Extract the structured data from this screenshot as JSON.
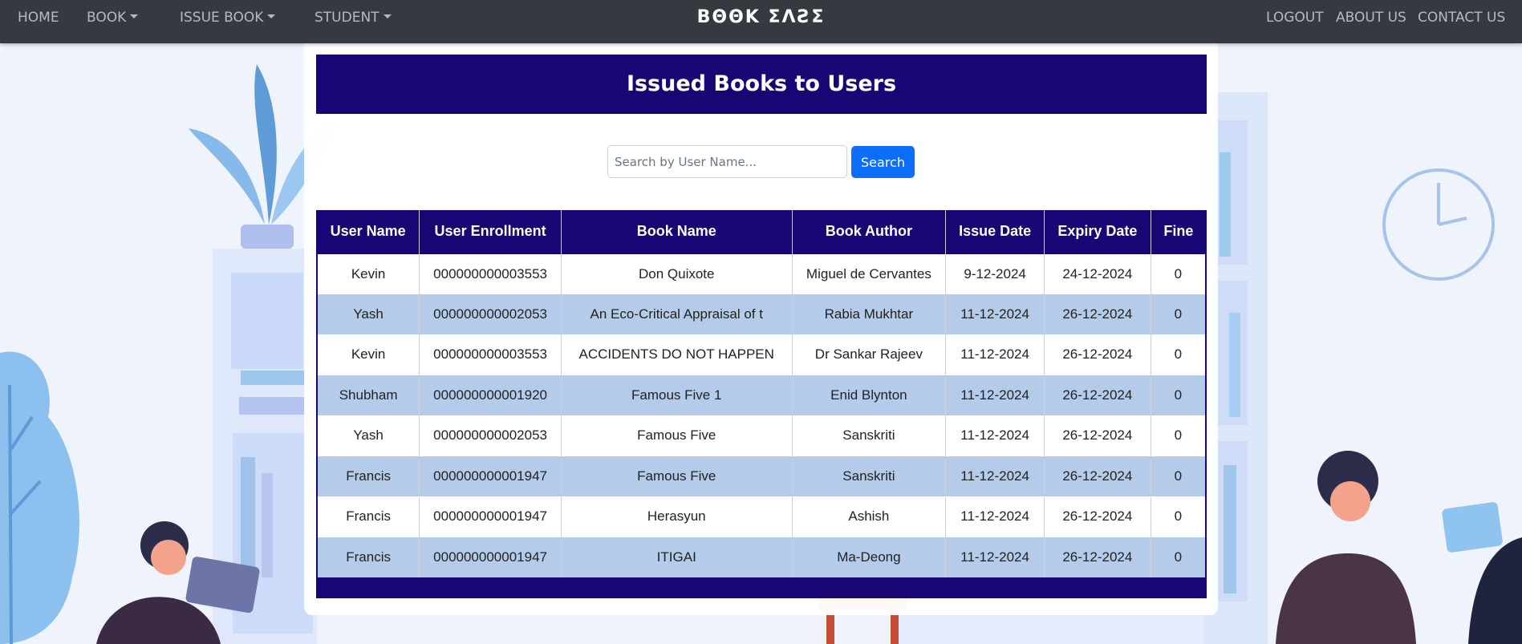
{
  "nav": {
    "home": "HOME",
    "book": "BOOK",
    "issue_book": "ISSUE BOOK",
    "student": "STUDENT",
    "brand": "BΘΘK ΣΛƧΣ",
    "logout": "LOGOUT",
    "about": "ABOUT US",
    "contact": "CONTACT US"
  },
  "page": {
    "title": "Issued Books to Users"
  },
  "search": {
    "placeholder": "Search by User Name...",
    "button": "Search"
  },
  "table": {
    "headers": [
      "User Name",
      "User Enrollment",
      "Book Name",
      "Book Author",
      "Issue Date",
      "Expiry Date",
      "Fine"
    ],
    "rows": [
      [
        "Kevin",
        "000000000003553",
        "Don Quixote",
        "Miguel de Cervantes",
        "9-12-2024",
        "24-12-2024",
        "0"
      ],
      [
        "Yash",
        "000000000002053",
        "An Eco-Critical Appraisal of t",
        "Rabia Mukhtar",
        "11-12-2024",
        "26-12-2024",
        "0"
      ],
      [
        "Kevin",
        "000000000003553",
        "ACCIDENTS DO NOT HAPPEN",
        "Dr Sankar Rajeev",
        "11-12-2024",
        "26-12-2024",
        "0"
      ],
      [
        "Shubham",
        "000000000001920",
        "Famous Five 1",
        "Enid Blynton",
        "11-12-2024",
        "26-12-2024",
        "0"
      ],
      [
        "Yash",
        "000000000002053",
        "Famous Five",
        "Sanskriti",
        "11-12-2024",
        "26-12-2024",
        "0"
      ],
      [
        "Francis",
        "000000000001947",
        "Famous Five",
        "Sanskriti",
        "11-12-2024",
        "26-12-2024",
        "0"
      ],
      [
        "Francis",
        "000000000001947",
        "Herasyun",
        "Ashish",
        "11-12-2024",
        "26-12-2024",
        "0"
      ],
      [
        "Francis",
        "000000000001947",
        "ITIGAI",
        "Ma-Deong",
        "11-12-2024",
        "26-12-2024",
        "0"
      ]
    ]
  },
  "colors": {
    "navbar": "#343a40",
    "header_bg": "#190674",
    "row_alt": "#b4cbe9",
    "button": "#0d6efd"
  }
}
